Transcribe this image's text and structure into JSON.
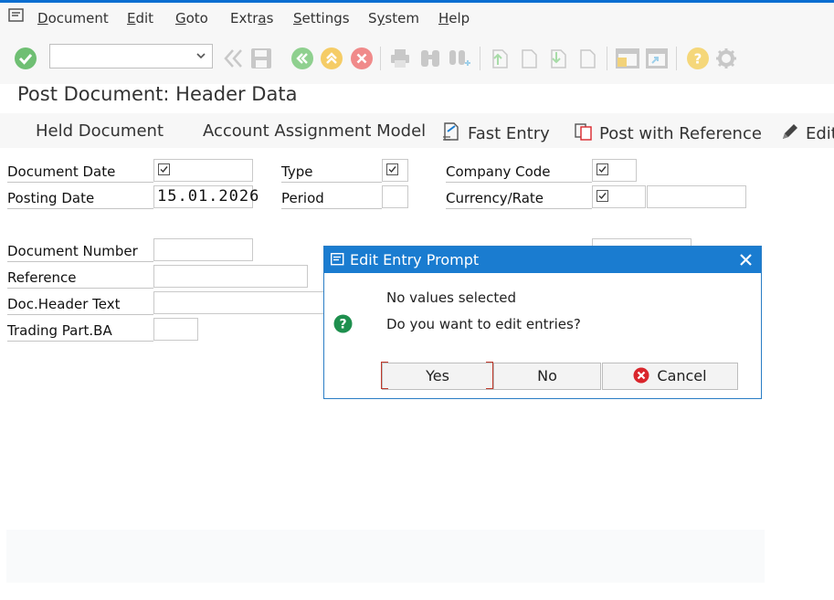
{
  "menubar": {
    "items": [
      {
        "pre": "",
        "accel": "D",
        "post": "ocument"
      },
      {
        "pre": "",
        "accel": "E",
        "post": "dit"
      },
      {
        "pre": "",
        "accel": "G",
        "post": "oto"
      },
      {
        "pre": "Extr",
        "accel": "a",
        "post": "s"
      },
      {
        "pre": "",
        "accel": "S",
        "post": "ettings"
      },
      {
        "pre": "S",
        "accel": "y",
        "post": "stem"
      },
      {
        "pre": "",
        "accel": "H",
        "post": "elp"
      }
    ]
  },
  "toolbar": {
    "command_field_value": ""
  },
  "page": {
    "title": "Post Document: Header Data"
  },
  "actions": {
    "held_document": "Held Document",
    "account_assignment_model": "Account Assignment Model",
    "fast_entry": "Fast Entry",
    "post_with_reference": "Post with Reference",
    "edit": "Edit"
  },
  "form": {
    "document_date_label": "Document Date",
    "posting_date_label": "Posting Date",
    "posting_date_value": "15.01.2026",
    "type_label": "Type",
    "period_label": "Period",
    "company_code_label": "Company Code",
    "currency_rate_label": "Currency/Rate",
    "document_number_label": "Document Number",
    "reference_label": "Reference",
    "doc_header_text_label": "Doc.Header Text",
    "trading_part_label": "Trading Part.BA"
  },
  "dialog": {
    "title": "Edit Entry Prompt",
    "line1": "No values selected",
    "line2": "Do you want to edit entries?",
    "yes": "Yes",
    "no": "No",
    "cancel": "Cancel"
  },
  "colors": {
    "accent": "#1a7cd0",
    "ok_green": "#5cb85c",
    "cancel_red": "#d9262c",
    "help_yellow": "#f0c020"
  }
}
